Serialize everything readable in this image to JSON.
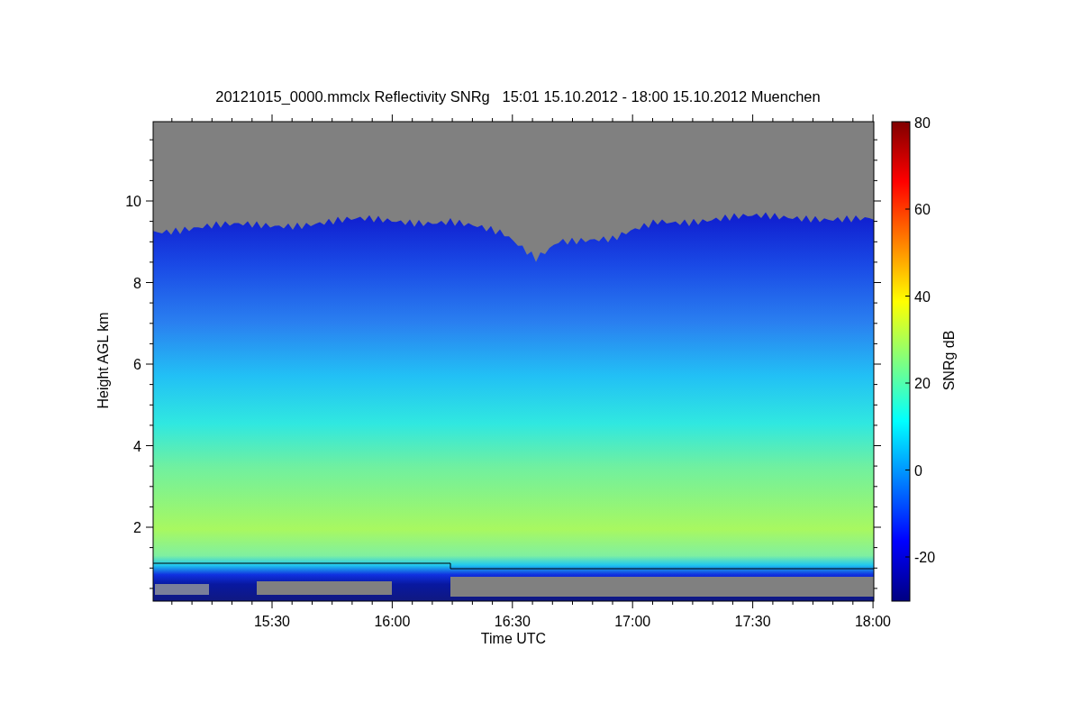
{
  "title": "20121015_0000.mmclx Reflectivity SNRg   15:01 15.10.2012 - 18:00 15.10.2012 Muenchen",
  "plot": {
    "xlabel": "Time UTC",
    "ylabel": "Height AGL km",
    "xticks": [
      "15:30",
      "16:00",
      "16:30",
      "17:00",
      "17:30",
      "18:00"
    ],
    "yticks": [
      "10",
      "8",
      "6",
      "4",
      "2"
    ]
  },
  "colorbar": {
    "label": "SNRg dB",
    "ticks": [
      "80",
      "60",
      "40",
      "20",
      "0",
      "-20"
    ]
  }
}
